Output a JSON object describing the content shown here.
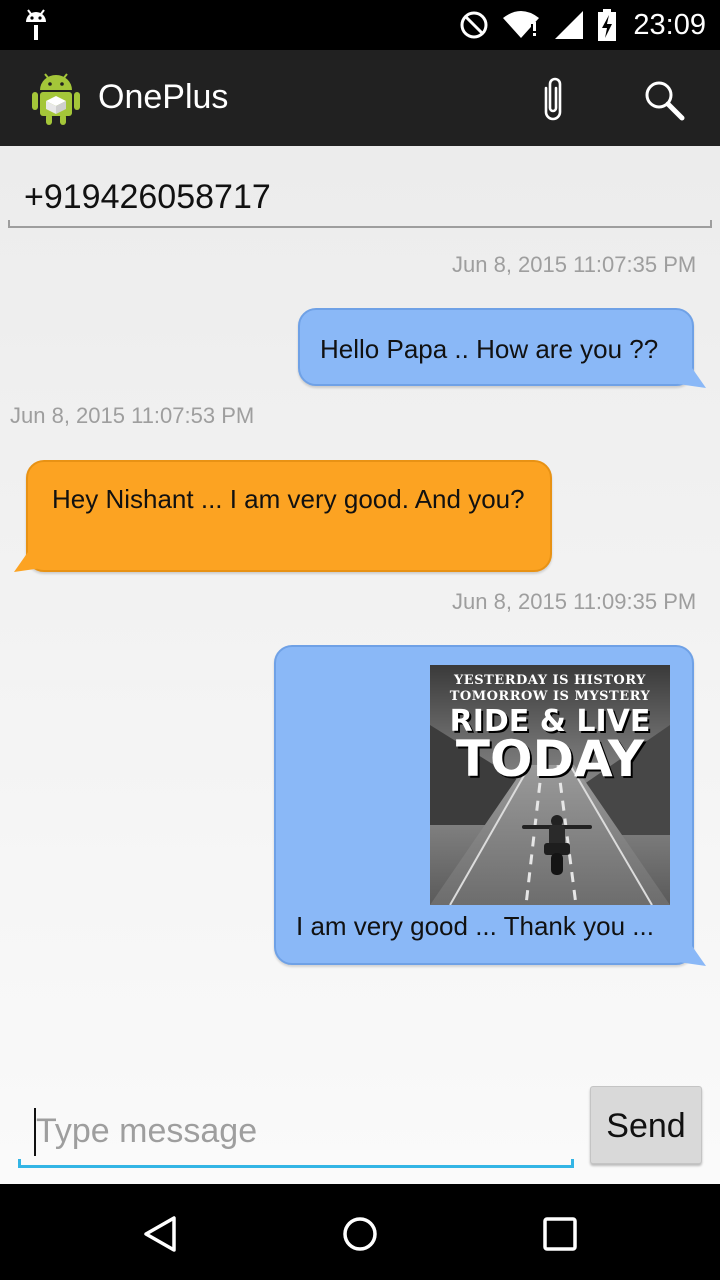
{
  "status_bar": {
    "time": "23:09",
    "icons": [
      "android-debug-icon",
      "no-disturb-icon",
      "wifi-icon",
      "signal-icon",
      "battery-charging-icon"
    ]
  },
  "action_bar": {
    "title": "OnePlus",
    "icons": [
      "app-icon",
      "paperclip-icon",
      "search-icon"
    ]
  },
  "recipient": {
    "number": "+919426058717"
  },
  "messages": [
    {
      "direction": "outgoing",
      "timestamp": "Jun 8, 2015 11:07:35 PM",
      "text": "Hello Papa .. How are you ??"
    },
    {
      "direction": "incoming",
      "timestamp": "Jun 8, 2015 11:07:53 PM",
      "text": "Hey Nishant ... I am very good. And you?"
    },
    {
      "direction": "outgoing",
      "timestamp": "Jun 8, 2015 11:09:35 PM",
      "text": "I am very good ... Thank you ...",
      "image": {
        "line1": "YESTERDAY IS HISTORY",
        "line1b": "TOMORROW IS MYSTERY",
        "line2": "RIDE & LIVE",
        "line3": "TODAY"
      }
    }
  ],
  "compose": {
    "placeholder": "Type message",
    "send_label": "Send"
  },
  "nav_bar": {
    "icons": [
      "back-icon",
      "home-icon",
      "recents-icon"
    ]
  },
  "colors": {
    "outgoing_bubble": "#8ab8f7",
    "incoming_bubble": "#fca322",
    "action_bar": "#212121",
    "input_accent": "#33b5e5"
  }
}
